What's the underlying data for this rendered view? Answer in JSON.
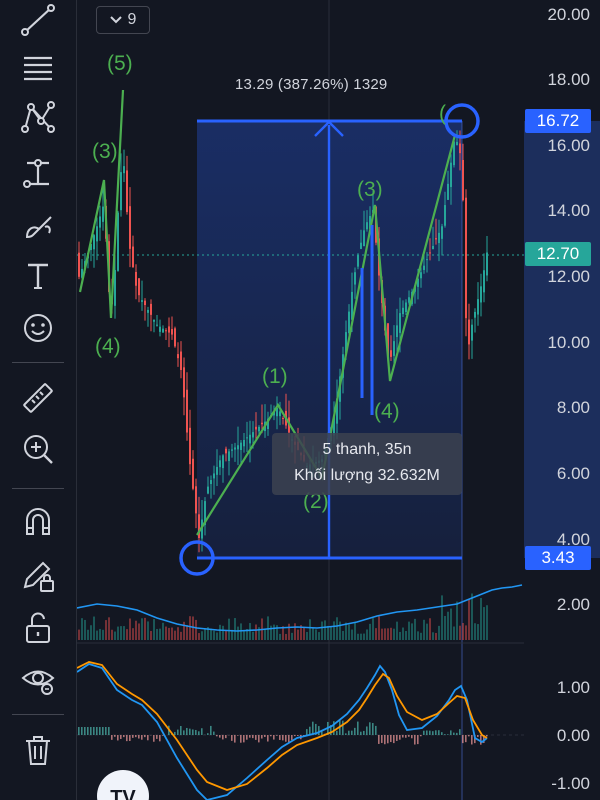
{
  "toolbar": {
    "tools": [
      {
        "name": "trend-line-tool",
        "icon": "trend-line-icon"
      },
      {
        "name": "fib-tool",
        "icon": "horizontal-lines-icon"
      },
      {
        "name": "pattern-tool",
        "icon": "pattern-icon"
      },
      {
        "name": "projection-tool",
        "icon": "projection-icon"
      },
      {
        "name": "brush-tool",
        "icon": "brush-icon"
      },
      {
        "name": "text-tool",
        "icon": "text-icon"
      },
      {
        "name": "emoji-tool",
        "icon": "smiley-icon"
      },
      {
        "name": "measure-tool",
        "icon": "ruler-icon"
      },
      {
        "name": "zoom-tool",
        "icon": "zoom-in-icon"
      },
      {
        "name": "magnet-tool",
        "icon": "magnet-icon"
      },
      {
        "name": "lock-drawing-tool",
        "icon": "pencil-lock-icon"
      },
      {
        "name": "unlock-tool",
        "icon": "unlock-icon"
      },
      {
        "name": "hide-tool",
        "icon": "eye-icon"
      },
      {
        "name": "delete-tool",
        "icon": "trash-icon"
      }
    ]
  },
  "wave_dropdown": {
    "value": "9"
  },
  "price_axis": {
    "labels": [
      "20.00",
      "18.00",
      "16.00",
      "14.00",
      "12.00",
      "10.00",
      "8.00",
      "6.00",
      "4.00",
      "2.00"
    ],
    "current_price": "12.70",
    "measure_high": "16.72",
    "measure_low": "3.43",
    "current_color": "#26a69a",
    "measure_color": "#2962ff"
  },
  "macd_axis": {
    "labels": [
      "1.00",
      "0.00",
      "-1.00"
    ]
  },
  "measure": {
    "label": "13.29 (387.26%) 1329",
    "bars_time": "5 thanh, 35n",
    "volume": "Khối lượng 32.632M"
  },
  "waves": [
    "(5)",
    "(3)",
    "(4)",
    "(1)",
    "(2)",
    "(3)",
    "(4)",
    "("
  ],
  "colors": {
    "background": "#131722",
    "up": "#26a69a",
    "down": "#ef5350",
    "wave": "#4caf50",
    "measure": "#2962ff"
  },
  "logo": "TV"
}
